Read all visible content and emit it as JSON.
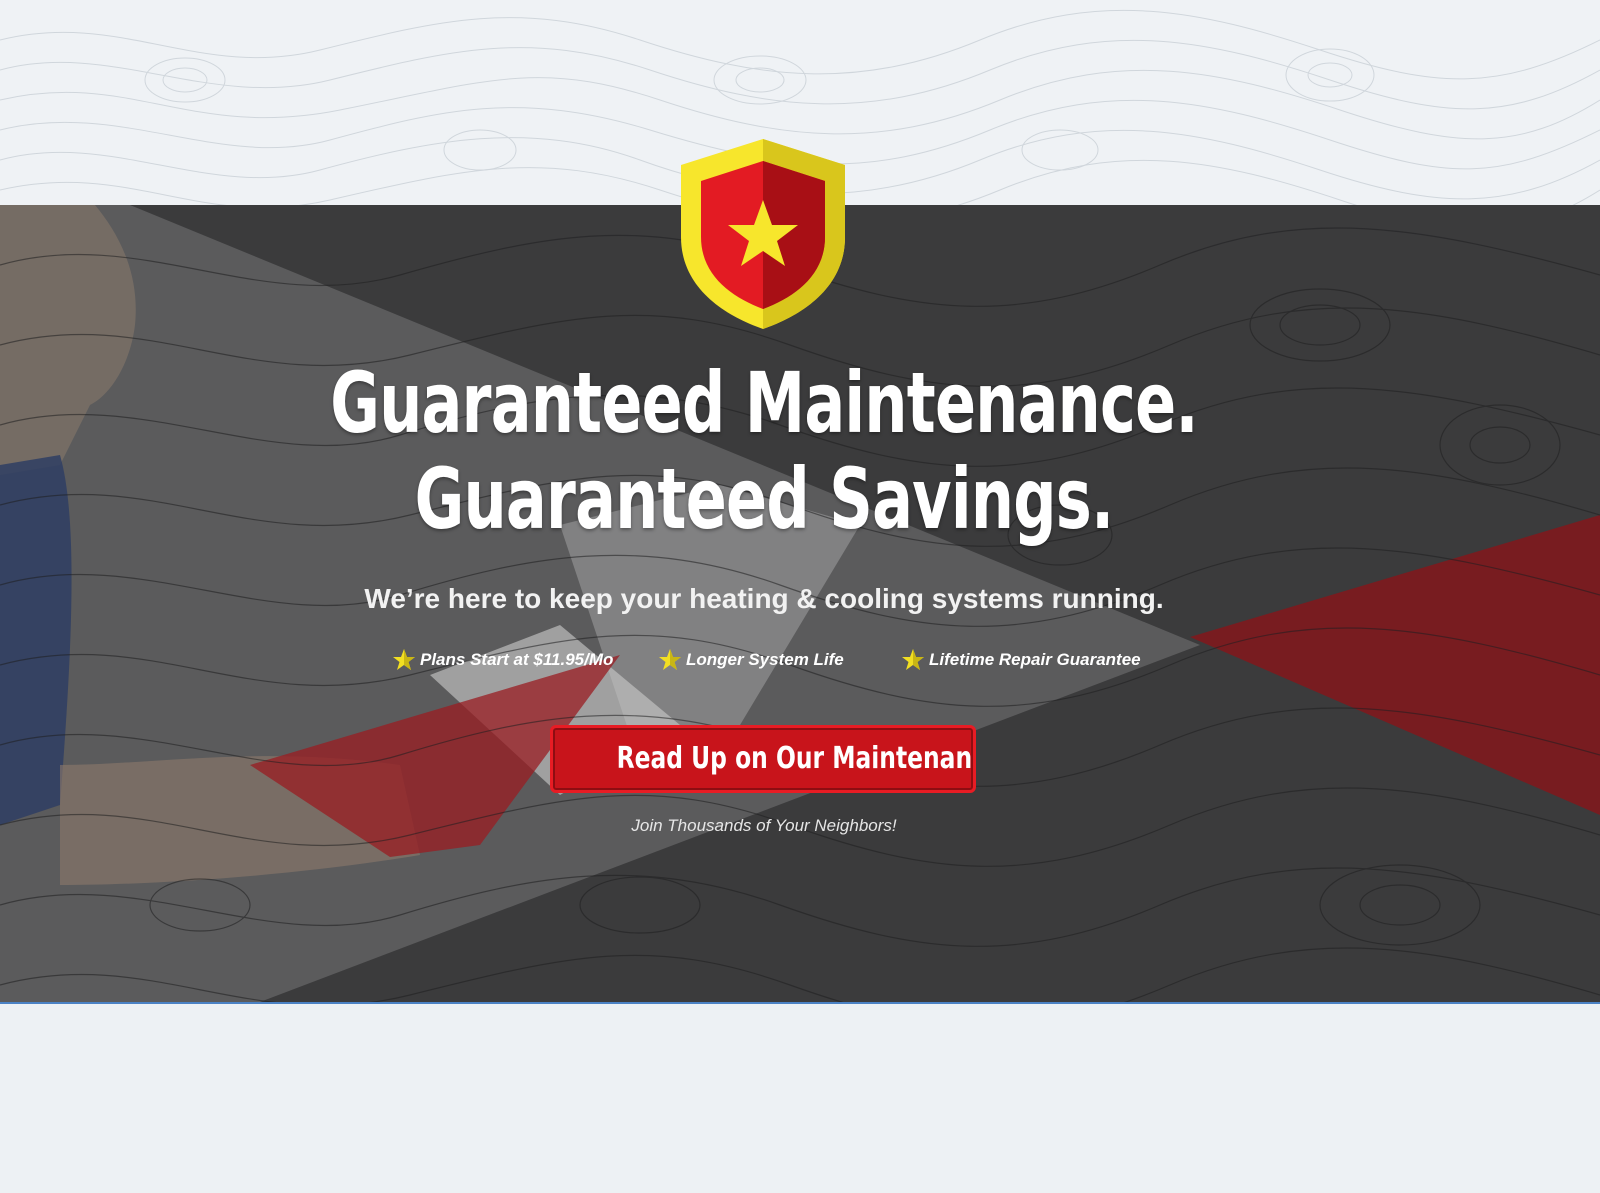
{
  "hero": {
    "headline_line1": "Guaranteed Maintenance.",
    "headline_line2": "Guaranteed Savings.",
    "subheadline": "We’re here to keep your heating & cooling systems running.",
    "benefits": [
      {
        "icon": "star-icon",
        "label": "Plans Start at $11.95/Mo"
      },
      {
        "icon": "star-icon",
        "label": "Longer System Life"
      },
      {
        "icon": "star-icon",
        "label": "Lifetime Repair Guarantee"
      }
    ],
    "cta_label": "Read Up on Our Maintenance Plan",
    "cta_subtext": "Join Thousands of Your Neighbors!"
  },
  "colors": {
    "hero_background": "#3b3b3c",
    "accent_red": "#c8141b",
    "shield_yellow": "#f5e12a",
    "page_background": "#eef2f5"
  },
  "icons": {
    "badge": "shield-star-icon",
    "bullet": "star-icon"
  }
}
